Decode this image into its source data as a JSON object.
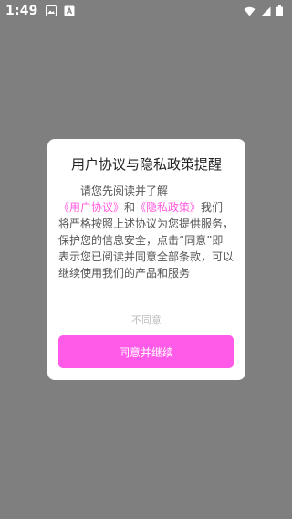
{
  "status_bar": {
    "time": "1:49",
    "icons": [
      "gallery-icon",
      "font-icon",
      "wifi-icon",
      "signal-icon",
      "battery-icon"
    ]
  },
  "dialog": {
    "title": "用户协议与隐私政策提醒",
    "body_prefix": "请您先阅读并了解",
    "link_user_agreement": "《用户协议》",
    "conjunction": "和",
    "link_privacy_policy": "《隐私政策》",
    "body_suffix": "我们将严格按照上述协议为您提供服务，保护您的信息安全，点击“同意”即表示您已阅读并同意全部条款，可以继续使用我们的产品和服务",
    "decline_label": "不同意",
    "accept_label": "同意并继续"
  },
  "colors": {
    "overlay": "#7f7f7f",
    "accent": "#ff5ae8",
    "link": "#ff5ae0"
  }
}
